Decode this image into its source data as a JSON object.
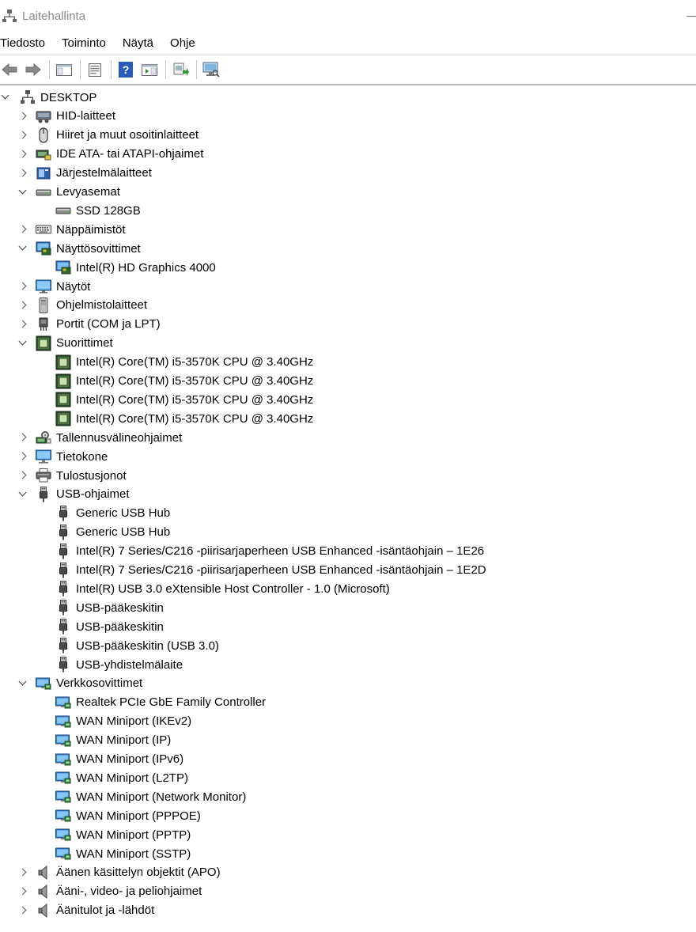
{
  "window": {
    "title": "Laitehallinta"
  },
  "menu": [
    "Tiedosto",
    "Toiminto",
    "Näytä",
    "Ohje"
  ],
  "toolbar": {
    "buttons": [
      "back-icon",
      "forward-icon",
      "show-hide-console-tree-icon",
      "properties-icon",
      "help-icon",
      "action-pane-icon",
      "update-driver-icon",
      "scan-hardware-icon"
    ]
  },
  "tree": [
    {
      "label": "DESKTOP",
      "level": 0,
      "state": "expanded",
      "icon": "computer-network-icon"
    },
    {
      "label": "HID-laitteet",
      "level": 1,
      "state": "collapsed",
      "icon": "hid-icon"
    },
    {
      "label": "Hiiret ja muut osoitinlaitteet",
      "level": 1,
      "state": "collapsed",
      "icon": "mouse-icon"
    },
    {
      "label": "IDE ATA- tai ATAPI-ohjaimet",
      "level": 1,
      "state": "collapsed",
      "icon": "ide-controller-icon"
    },
    {
      "label": "Järjestelmälaitteet",
      "level": 1,
      "state": "collapsed",
      "icon": "system-devices-icon"
    },
    {
      "label": "Levyasemat",
      "level": 1,
      "state": "expanded",
      "icon": "disk-drive-icon"
    },
    {
      "label": "SSD 128GB",
      "level": 2,
      "state": "leaf",
      "icon": "disk-drive-icon"
    },
    {
      "label": "Näppäimistöt",
      "level": 1,
      "state": "collapsed",
      "icon": "keyboard-icon"
    },
    {
      "label": "Näyttösovittimet",
      "level": 1,
      "state": "expanded",
      "icon": "display-adapter-icon"
    },
    {
      "label": "Intel(R) HD Graphics 4000",
      "level": 2,
      "state": "leaf",
      "icon": "display-adapter-icon"
    },
    {
      "label": "Näytöt",
      "level": 1,
      "state": "collapsed",
      "icon": "monitor-icon"
    },
    {
      "label": "Ohjelmistolaitteet",
      "level": 1,
      "state": "collapsed",
      "icon": "software-device-icon"
    },
    {
      "label": "Portit (COM ja LPT)",
      "level": 1,
      "state": "collapsed",
      "icon": "port-icon"
    },
    {
      "label": "Suorittimet",
      "level": 1,
      "state": "expanded",
      "icon": "processor-icon"
    },
    {
      "label": "Intel(R) Core(TM) i5-3570K CPU @ 3.40GHz",
      "level": 2,
      "state": "leaf",
      "icon": "processor-icon"
    },
    {
      "label": "Intel(R) Core(TM) i5-3570K CPU @ 3.40GHz",
      "level": 2,
      "state": "leaf",
      "icon": "processor-icon"
    },
    {
      "label": "Intel(R) Core(TM) i5-3570K CPU @ 3.40GHz",
      "level": 2,
      "state": "leaf",
      "icon": "processor-icon"
    },
    {
      "label": "Intel(R) Core(TM) i5-3570K CPU @ 3.40GHz",
      "level": 2,
      "state": "leaf",
      "icon": "processor-icon"
    },
    {
      "label": "Tallennusvälineohjaimet",
      "level": 1,
      "state": "collapsed",
      "icon": "storage-controller-icon"
    },
    {
      "label": "Tietokone",
      "level": 1,
      "state": "collapsed",
      "icon": "computer-icon"
    },
    {
      "label": "Tulostusjonot",
      "level": 1,
      "state": "collapsed",
      "icon": "printer-icon"
    },
    {
      "label": "USB-ohjaimet",
      "level": 1,
      "state": "expanded",
      "icon": "usb-icon"
    },
    {
      "label": "Generic USB Hub",
      "level": 2,
      "state": "leaf",
      "icon": "usb-icon"
    },
    {
      "label": "Generic USB Hub",
      "level": 2,
      "state": "leaf",
      "icon": "usb-icon"
    },
    {
      "label": "Intel(R) 7 Series/C216 -piirisarjaperheen USB Enhanced -isäntäohjain – 1E26",
      "level": 2,
      "state": "leaf",
      "icon": "usb-icon"
    },
    {
      "label": "Intel(R) 7 Series/C216 -piirisarjaperheen USB Enhanced -isäntäohjain – 1E2D",
      "level": 2,
      "state": "leaf",
      "icon": "usb-icon"
    },
    {
      "label": "Intel(R) USB 3.0 eXtensible Host Controller - 1.0 (Microsoft)",
      "level": 2,
      "state": "leaf",
      "icon": "usb-icon"
    },
    {
      "label": "USB-pääkeskitin",
      "level": 2,
      "state": "leaf",
      "icon": "usb-icon"
    },
    {
      "label": "USB-pääkeskitin",
      "level": 2,
      "state": "leaf",
      "icon": "usb-icon"
    },
    {
      "label": "USB-pääkeskitin (USB 3.0)",
      "level": 2,
      "state": "leaf",
      "icon": "usb-icon"
    },
    {
      "label": "USB-yhdistelmälaite",
      "level": 2,
      "state": "leaf",
      "icon": "usb-icon"
    },
    {
      "label": "Verkkosovittimet",
      "level": 1,
      "state": "expanded",
      "icon": "network-adapter-icon"
    },
    {
      "label": "Realtek PCIe GbE Family Controller",
      "level": 2,
      "state": "leaf",
      "icon": "network-adapter-icon"
    },
    {
      "label": "WAN Miniport (IKEv2)",
      "level": 2,
      "state": "leaf",
      "icon": "network-adapter-icon"
    },
    {
      "label": "WAN Miniport (IP)",
      "level": 2,
      "state": "leaf",
      "icon": "network-adapter-icon"
    },
    {
      "label": "WAN Miniport (IPv6)",
      "level": 2,
      "state": "leaf",
      "icon": "network-adapter-icon"
    },
    {
      "label": "WAN Miniport (L2TP)",
      "level": 2,
      "state": "leaf",
      "icon": "network-adapter-icon"
    },
    {
      "label": "WAN Miniport (Network Monitor)",
      "level": 2,
      "state": "leaf",
      "icon": "network-adapter-icon"
    },
    {
      "label": "WAN Miniport (PPPOE)",
      "level": 2,
      "state": "leaf",
      "icon": "network-adapter-icon"
    },
    {
      "label": "WAN Miniport (PPTP)",
      "level": 2,
      "state": "leaf",
      "icon": "network-adapter-icon"
    },
    {
      "label": "WAN Miniport (SSTP)",
      "level": 2,
      "state": "leaf",
      "icon": "network-adapter-icon"
    },
    {
      "label": "Äänen käsittelyn objektit (APO)",
      "level": 1,
      "state": "collapsed",
      "icon": "speaker-icon"
    },
    {
      "label": "Ääni-, video- ja peliohjaimet",
      "level": 1,
      "state": "collapsed",
      "icon": "speaker-icon"
    },
    {
      "label": "Äänitulot ja -lähdöt",
      "level": 1,
      "state": "collapsed",
      "icon": "speaker-icon"
    }
  ]
}
